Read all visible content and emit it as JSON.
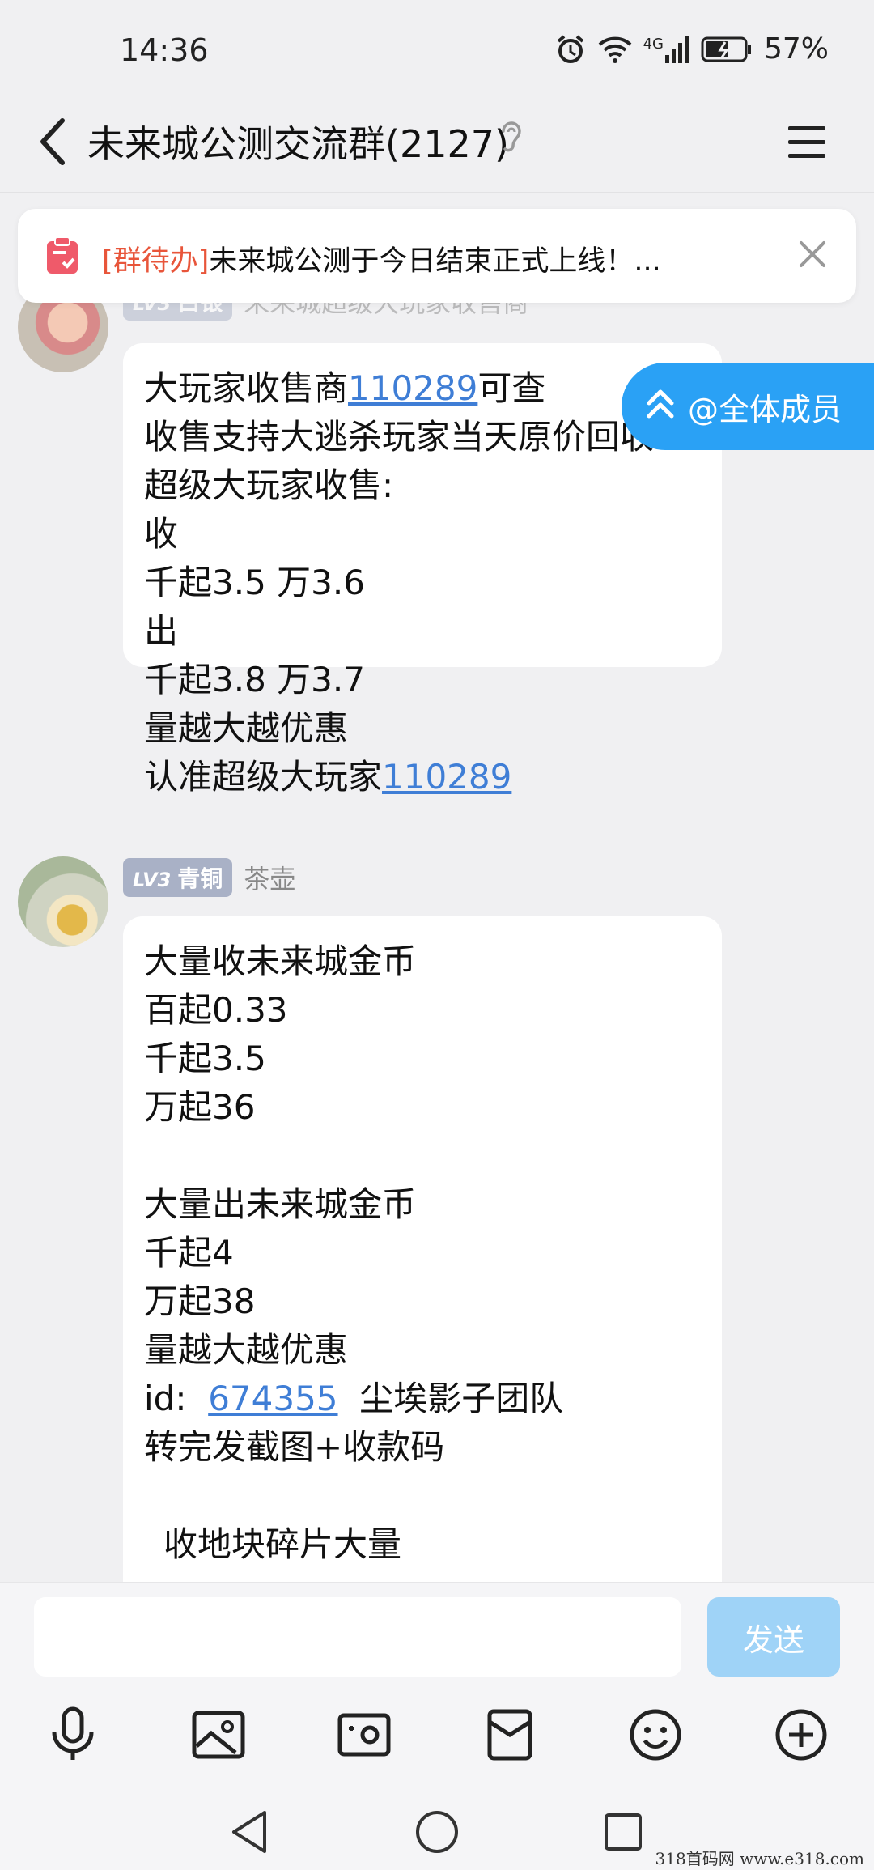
{
  "status": {
    "time": "14:36",
    "network": "4G",
    "battery": "57%"
  },
  "header": {
    "title": "未来城公测交流群(2127)"
  },
  "todo": {
    "tag": "[群待办]",
    "text": "未来城公测于今日结束正式上线！..."
  },
  "at_all": {
    "label": "@全体成员"
  },
  "messages": [
    {
      "level": "LV3",
      "rank": "白银",
      "nick": "未来城超级大玩家收售商",
      "lines": {
        "l1a": "大玩家收售商",
        "l1link": "110289",
        "l1b": "可查",
        "l2": "收售支持大逃杀玩家当天原价回收",
        "l3": "超级大玩家收售:",
        "l4": "收",
        "l5": "千起3.5 万3.6",
        "l6": "出",
        "l7": "千起3.8 万3.7",
        "l8": "量越大越优惠",
        "l9a": "认准超级大玩家",
        "l9link": "110289"
      }
    },
    {
      "level": "LV3",
      "rank": "青铜",
      "nick": "茶壶",
      "lines": {
        "l1": "大量收未来城金币",
        "l2": "百起0.33",
        "l3": "千起3.5",
        "l4": "万起36",
        "l5": "大量出未来城金币",
        "l6": "千起4",
        "l7": "万起38",
        "l8": "量越大越优惠",
        "l9a": "id:",
        "l9link": "674355",
        "l9b": "尘埃影子团队",
        "l10": "转完发截图+收款码",
        "l11": "收地块碎片大量"
      }
    }
  ],
  "composer": {
    "send_label": "发送",
    "value": ""
  },
  "watermark": "318首码网  www.e318.com"
}
